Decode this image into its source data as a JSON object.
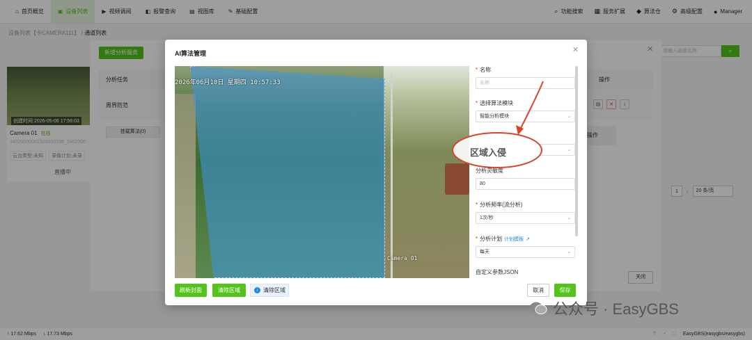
{
  "nav": {
    "items": [
      {
        "label": "首页概览",
        "icon": "home-icon",
        "active": false
      },
      {
        "label": "设备列表",
        "icon": "device-icon",
        "active": true
      },
      {
        "label": "视频调阅",
        "icon": "video-icon",
        "active": false
      },
      {
        "label": "报警查询",
        "icon": "alarm-icon",
        "active": false
      },
      {
        "label": "视图库",
        "icon": "image-icon",
        "active": false
      },
      {
        "label": "基础配置",
        "icon": "edit-icon",
        "active": false
      }
    ],
    "right": [
      {
        "label": "功能搜索",
        "icon": "search-icon"
      },
      {
        "label": "服务扩展",
        "icon": "grid-icon"
      },
      {
        "label": "算法仓",
        "icon": "dropbox-icon"
      },
      {
        "label": "高级配置",
        "icon": "gear-icon"
      },
      {
        "label": "Manager",
        "icon": "user-icon"
      }
    ]
  },
  "breadcrumb": {
    "part1": "设备列表【卡CAMERA111】",
    "sep": "/",
    "part2": "通道列表"
  },
  "bg_card": {
    "thumb_tag": "创建时间:2026-05-06 17:56:03",
    "camera": "Camera 01",
    "state": "在线",
    "id": "34020000001320000198_3402000",
    "tag1": "云台类型:未知",
    "tag2": "录像计划:未录",
    "live": "直播中"
  },
  "bg_modal": {
    "add_button": "新增分析服务",
    "col_task": "分析任务",
    "col_ops": "操作",
    "row_task": "周界防范",
    "mount": "挂载算法(0)",
    "col_ops2": "操作",
    "page": "1",
    "page_size": "20 条/页",
    "search_placeholder": "请输入通道名称",
    "close": "关闭"
  },
  "status": {
    "up": "↑ 17.62 Mbps",
    "down": "↓ 17.73 Mbps",
    "right": "EasyGBS(easygbs/easygbs)"
  },
  "modal": {
    "title": "AI算法管理",
    "video": {
      "timestamp": "2026年06月10日 星期四 10:57:33",
      "camera": "Camera 01"
    },
    "buttons": {
      "refresh": "刷新封面",
      "clear": "清除区域",
      "tip": "清除区域",
      "cancel": "取消",
      "save": "保存"
    },
    "form": {
      "name_label": "名称",
      "name_placeholder": "名称",
      "module_label": "选择算法模块",
      "module_value": "智能分析模块",
      "algo_value": "区域入侵",
      "sensitivity_label": "分析灵敏度",
      "sensitivity_value": "80",
      "freq_label": "分析频率(流分析)",
      "freq_value": "1次/秒",
      "plan_label": "分析计划",
      "plan_link": "计划模板",
      "plan_value": "每天",
      "json_label": "自定义参数JSON"
    }
  },
  "watermark": {
    "text": "公众号 · EasyGBS"
  },
  "colors": {
    "accent": "#52c41a",
    "annotation": "#d6452a",
    "region": "#3c96e6"
  }
}
